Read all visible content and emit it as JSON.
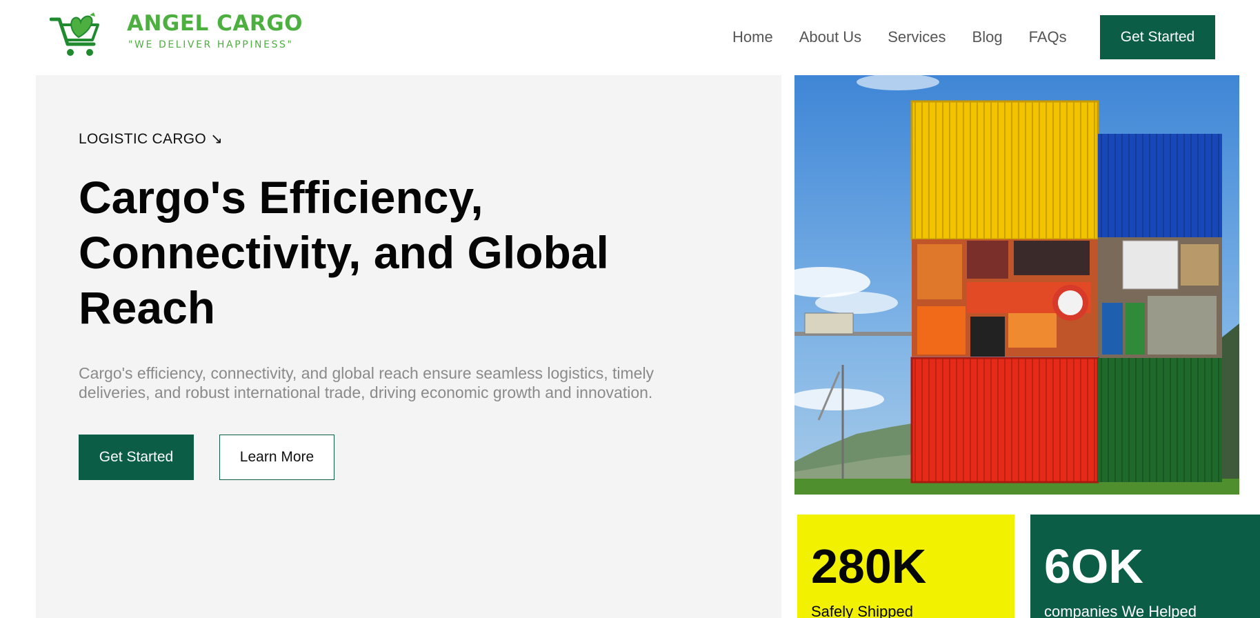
{
  "brand": {
    "name": "ANGEL CARGO",
    "tagline": "\"WE DELIVER HAPPINESS\"",
    "color": "#4caf3f"
  },
  "nav": {
    "items": [
      {
        "label": "Home"
      },
      {
        "label": "About Us"
      },
      {
        "label": "Services"
      },
      {
        "label": "Blog"
      },
      {
        "label": "FAQs"
      }
    ],
    "cta_label": "Get Started"
  },
  "hero": {
    "eyebrow": "LOGISTIC CARGO ↘",
    "title": "Cargo's Efficiency, Connectivity, and Global Reach",
    "description": "Cargo's efficiency, connectivity, and global reach ensure seamless logistics, timely deliveries, and robust international trade, driving economic growth and innovation.",
    "primary_button": "Get Started",
    "secondary_button": "Learn More",
    "image_alt": "Stacked colorful shipping containers and cargo"
  },
  "stats": [
    {
      "value": "280K",
      "label": "Safely Shipped"
    },
    {
      "value": "6OK",
      "label": "companies We Helped"
    }
  ],
  "colors": {
    "accent": "#0b5e45",
    "highlight": "#f2f200",
    "panel": "#f4f4f4"
  }
}
